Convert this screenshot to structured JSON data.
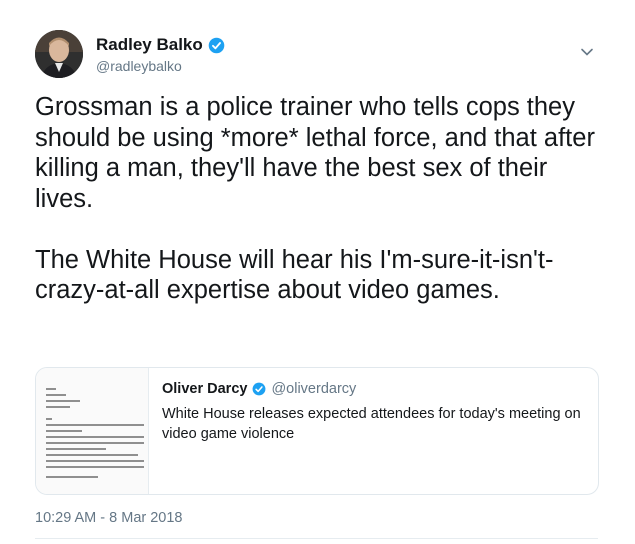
{
  "author": {
    "name": "Radley Balko",
    "handle": "@radleybalko",
    "verified": true
  },
  "tweet": {
    "text": "Grossman is a police trainer who tells cops they should be using *more* lethal force, and that after killing a man, they'll have the best sex of their lives.\n\nThe White House will hear his I'm-sure-it-isn't-crazy-at-all expertise about video games.",
    "timestamp": "10:29 AM - 8 Mar 2018"
  },
  "quoted_tweet": {
    "name": "Oliver Darcy",
    "handle": "@oliverdarcy",
    "verified": true,
    "text": "White House releases expected attendees for today's meeting on video game violence"
  },
  "colors": {
    "accent": "#1da1f2",
    "secondary_text": "#657786",
    "border": "#e1e8ed"
  },
  "icons": {
    "verified": "verified-badge-icon",
    "menu": "chevron-down-icon"
  }
}
